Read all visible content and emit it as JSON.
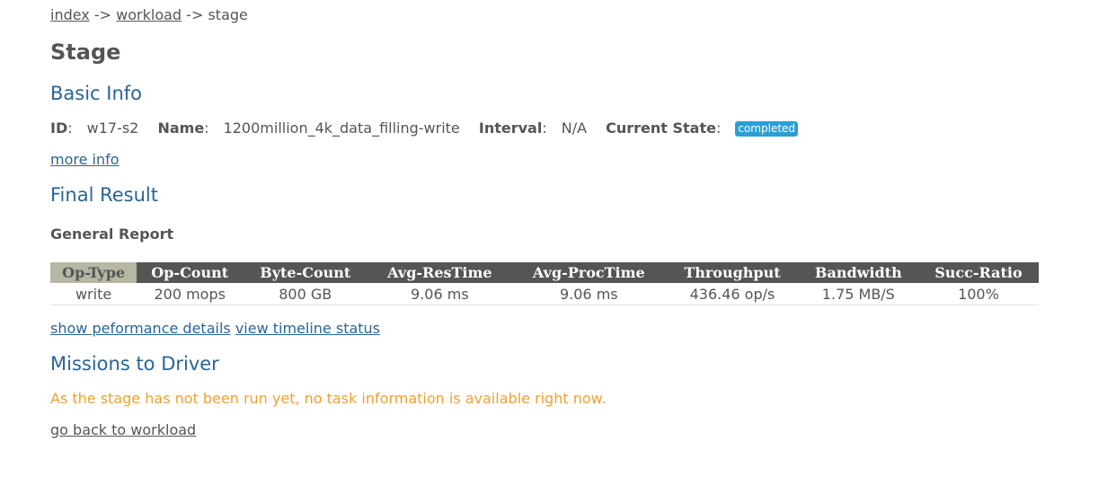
{
  "breadcrumb": {
    "index": "index",
    "sep1": "->",
    "workload": "workload",
    "sep2": "->",
    "current": "stage"
  },
  "page_title": "Stage",
  "basic_info": {
    "heading": "Basic Info",
    "id_label": "ID",
    "id_value": "w17-s2",
    "name_label": "Name",
    "name_value": "1200million_4k_data_filling-write",
    "interval_label": "Interval",
    "interval_value": "N/A",
    "state_label": "Current State",
    "state_value": "completed",
    "more_info": "more info"
  },
  "final_result": {
    "heading": "Final Result",
    "report_title": "General Report",
    "columns": [
      "Op-Type",
      "Op-Count",
      "Byte-Count",
      "Avg-ResTime",
      "Avg-ProcTime",
      "Throughput",
      "Bandwidth",
      "Succ-Ratio"
    ],
    "rows": [
      [
        "write",
        "200 mops",
        "800 GB",
        "9.06 ms",
        "9.06 ms",
        "436.46 op/s",
        "1.75 MB/S",
        "100%"
      ]
    ],
    "perf_link": "show peformance details",
    "timeline_link": "view timeline status"
  },
  "missions": {
    "heading": "Missions to Driver",
    "notice": "As the stage has not been run yet, no task information is available right now."
  },
  "back_link": "go back to workload",
  "colors": {
    "heading": "#2a6496",
    "badge": "#2a9fd6",
    "notice": "#f0a030",
    "table_header": "#555555",
    "table_header_first": "#b7b7a4"
  }
}
